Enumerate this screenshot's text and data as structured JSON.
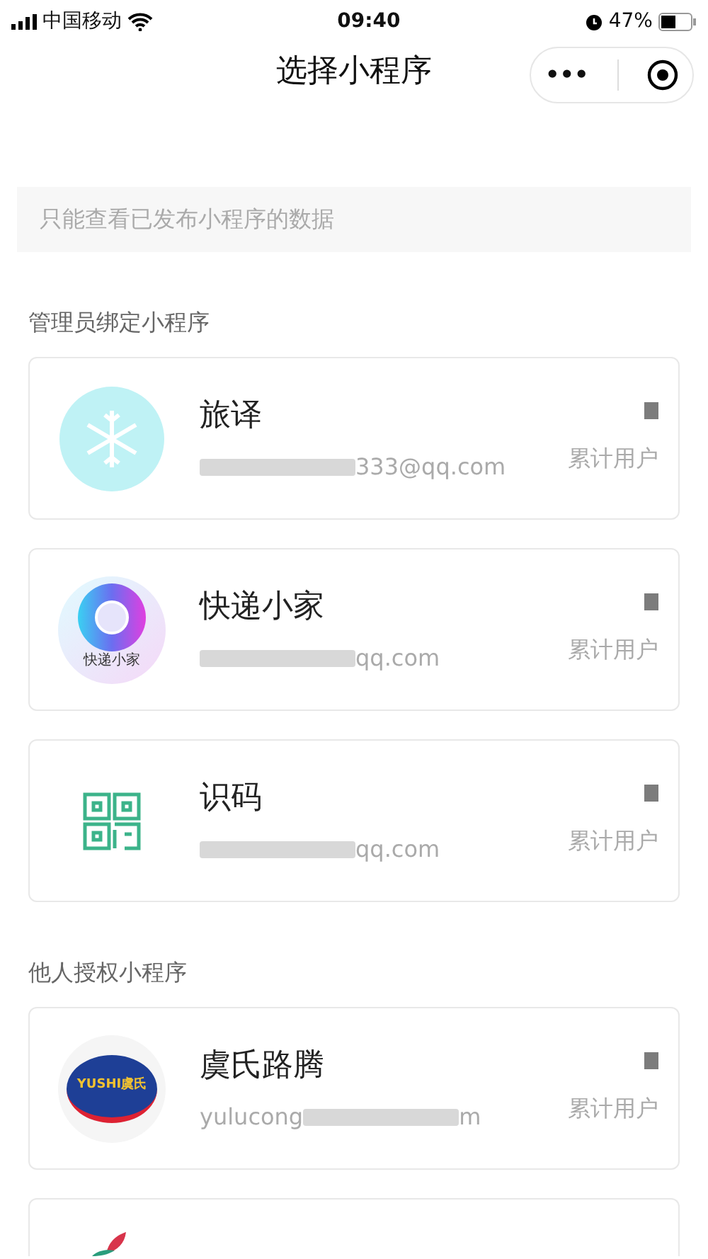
{
  "status_bar": {
    "carrier": "中国移动",
    "time": "09:40",
    "battery": "47%"
  },
  "title": "选择小程序",
  "capsule": {
    "more": "•••"
  },
  "notice": "只能查看已发布小程序的数据",
  "sections": [
    {
      "label": "管理员绑定小程序",
      "apps": [
        {
          "kind": "snowflake",
          "name": "旅译",
          "account": "333@qq.com",
          "stat_label": "累计用户"
        },
        {
          "kind": "disc",
          "name": "快递小家",
          "icon_caption": "快递小家",
          "account": "qq.com",
          "stat_label": "累计用户"
        },
        {
          "kind": "qr",
          "name": "识码",
          "account": "qq.com",
          "stat_label": "累计用户"
        }
      ]
    },
    {
      "label": "他人授权小程序",
      "apps": [
        {
          "kind": "badge",
          "icon_caption": "YUSHI虞氏",
          "name": "虞氏路腾",
          "account": "yulucong",
          "account_tail": "m",
          "stat_label": "累计用户"
        },
        {
          "kind": "partial"
        }
      ]
    }
  ]
}
